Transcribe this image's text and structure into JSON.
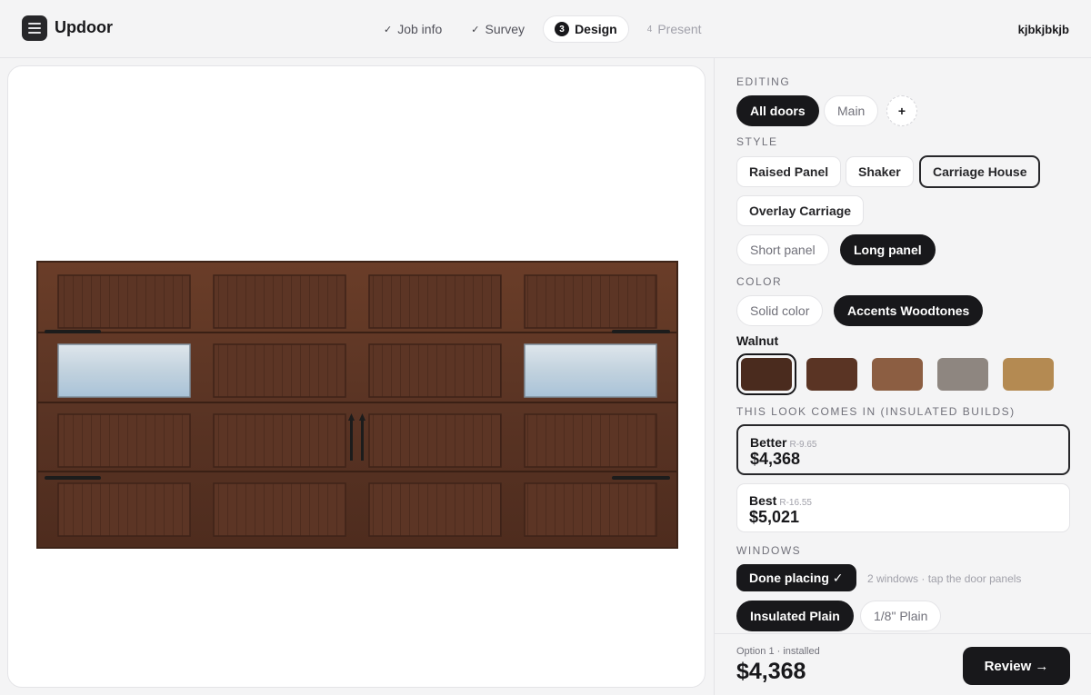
{
  "header": {
    "brand": "Updoor",
    "steps": [
      {
        "marker": "✓",
        "label": "Job info"
      },
      {
        "marker": "✓",
        "label": "Survey"
      },
      {
        "marker": "3",
        "label": "Design"
      },
      {
        "marker": "4",
        "label": "Present"
      }
    ],
    "active_step": 2,
    "user": "kjbkjbkjb"
  },
  "panel": {
    "editing": {
      "label": "EDITING",
      "options": [
        "All doors",
        "Main"
      ],
      "selected": "All doors",
      "add_label": "+"
    },
    "style": {
      "label": "STYLE",
      "options": [
        "Raised Panel",
        "Shaker",
        "Carriage House",
        "Overlay Carriage"
      ],
      "selected": "Carriage House",
      "panel_options": [
        "Short panel",
        "Long panel"
      ],
      "panel_selected": "Long panel"
    },
    "color": {
      "label": "COLOR",
      "options": [
        "Solid color",
        "Accents Woodtones"
      ],
      "selected": "Accents Woodtones",
      "selected_name": "Walnut",
      "swatches": [
        "#4a2b1e",
        "#5a3424",
        "#8c5e42",
        "#8e8680",
        "#b48a52"
      ],
      "selected_swatch": 0
    },
    "builds": {
      "label": "THIS LOOK COMES IN (INSULATED BUILDS)",
      "options": [
        {
          "tier": "Better",
          "r_value": "R-9.65",
          "price": "$4,368"
        },
        {
          "tier": "Best",
          "r_value": "R-16.55",
          "price": "$5,021"
        }
      ],
      "selected": 0
    },
    "windows": {
      "label": "WINDOWS",
      "done_label": "Done placing ✓",
      "hint": "2 windows · tap the door panels",
      "glass_options": [
        "Insulated Plain",
        "1/8\" Plain"
      ],
      "glass_selected": "Insulated Plain"
    }
  },
  "footer": {
    "option_note": "Option 1 · installed",
    "total": "$4,368",
    "review_label": "Review →"
  },
  "door": {
    "color": "#5a3424",
    "frame_color": "#3d2317",
    "window_count": 2
  }
}
